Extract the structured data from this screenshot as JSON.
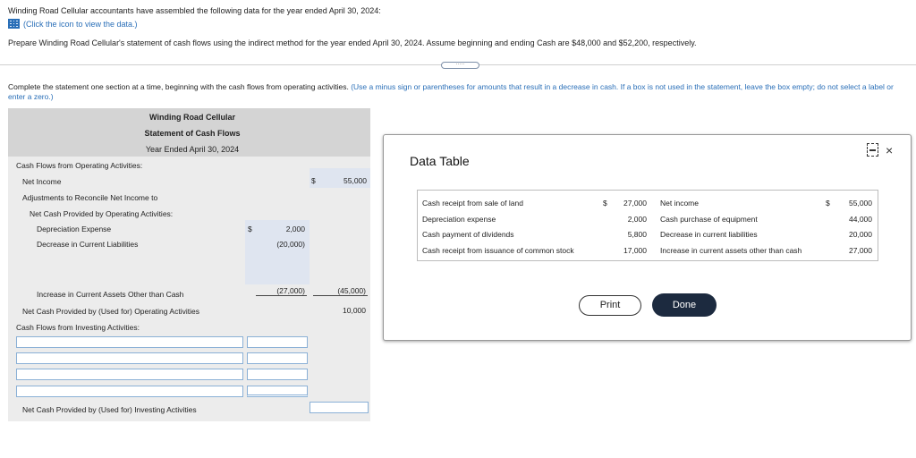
{
  "intro": "Winding Road Cellular accountants have assembled the following data for the year ended April 30, 2024:",
  "click_link": "(Click the icon to view the data.)",
  "prepare": "Prepare Winding Road Cellular's statement of cash flows using the indirect method for the year ended April 30, 2024. Assume beginning and ending Cash are $48,000 and $52,200, respectively.",
  "instructions": {
    "main": "Complete the statement one section at a time, beginning with the cash flows from operating activities. ",
    "hint": "(Use a minus sign or parentheses for amounts that result in a decrease in cash. If a box is not used in the statement, leave the box empty; do not select a label or enter a zero.)"
  },
  "statement": {
    "company": "Winding Road Cellular",
    "title": "Statement of Cash Flows",
    "period": "Year Ended April 30, 2024",
    "operating_header": "Cash Flows from Operating Activities:",
    "net_income_label": "Net Income",
    "net_income_dollar": "$",
    "net_income_value": "55,000",
    "adjust_label_1": "Adjustments to Reconcile Net Income to",
    "adjust_label_2": "Net Cash Provided by Operating Activities:",
    "depreciation_label": "Depreciation Expense",
    "depreciation_dollar": "$",
    "depreciation_value": "2,000",
    "dec_liab_label": "Decrease in Current Liabilities",
    "dec_liab_value": "(20,000)",
    "inc_assets_label": "Increase in Current Assets Other than Cash",
    "inc_assets_value": "(27,000)",
    "total_adjust_value": "(45,000)",
    "net_operating_label": "Net Cash Provided by (Used for) Operating Activities",
    "net_operating_value": "10,000",
    "investing_header": "Cash Flows from Investing Activities:",
    "net_investing_label": "Net Cash Provided by (Used for) Investing Activities"
  },
  "modal": {
    "title": "Data Table",
    "rows": [
      {
        "left_label": "Cash receipt from sale of land",
        "left_dollar": "$",
        "left_value": "27,000",
        "right_label": "Net income",
        "right_dollar": "$",
        "right_value": "55,000"
      },
      {
        "left_label": "Depreciation expense",
        "left_dollar": "",
        "left_value": "2,000",
        "right_label": "Cash purchase of equipment",
        "right_dollar": "",
        "right_value": "44,000"
      },
      {
        "left_label": "Cash payment of dividends",
        "left_dollar": "",
        "left_value": "5,800",
        "right_label": "Decrease in current liabilities",
        "right_dollar": "",
        "right_value": "20,000"
      },
      {
        "left_label": "Cash receipt from issuance of common stock",
        "left_dollar": "",
        "left_value": "17,000",
        "right_label": "Increase in current assets other than cash",
        "right_dollar": "",
        "right_value": "27,000"
      }
    ],
    "print_label": "Print",
    "done_label": "Done",
    "close_glyph": "×"
  },
  "icons": {
    "data_icon": "table-grid-icon",
    "expand": "expand-dots-icon",
    "minimize": "minimize-icon",
    "close": "close-icon"
  },
  "colors": {
    "link": "#2a6fb8",
    "header_bg": "#d4d4d4",
    "body_bg": "#ececec",
    "done_bg": "#1c2a3f"
  }
}
